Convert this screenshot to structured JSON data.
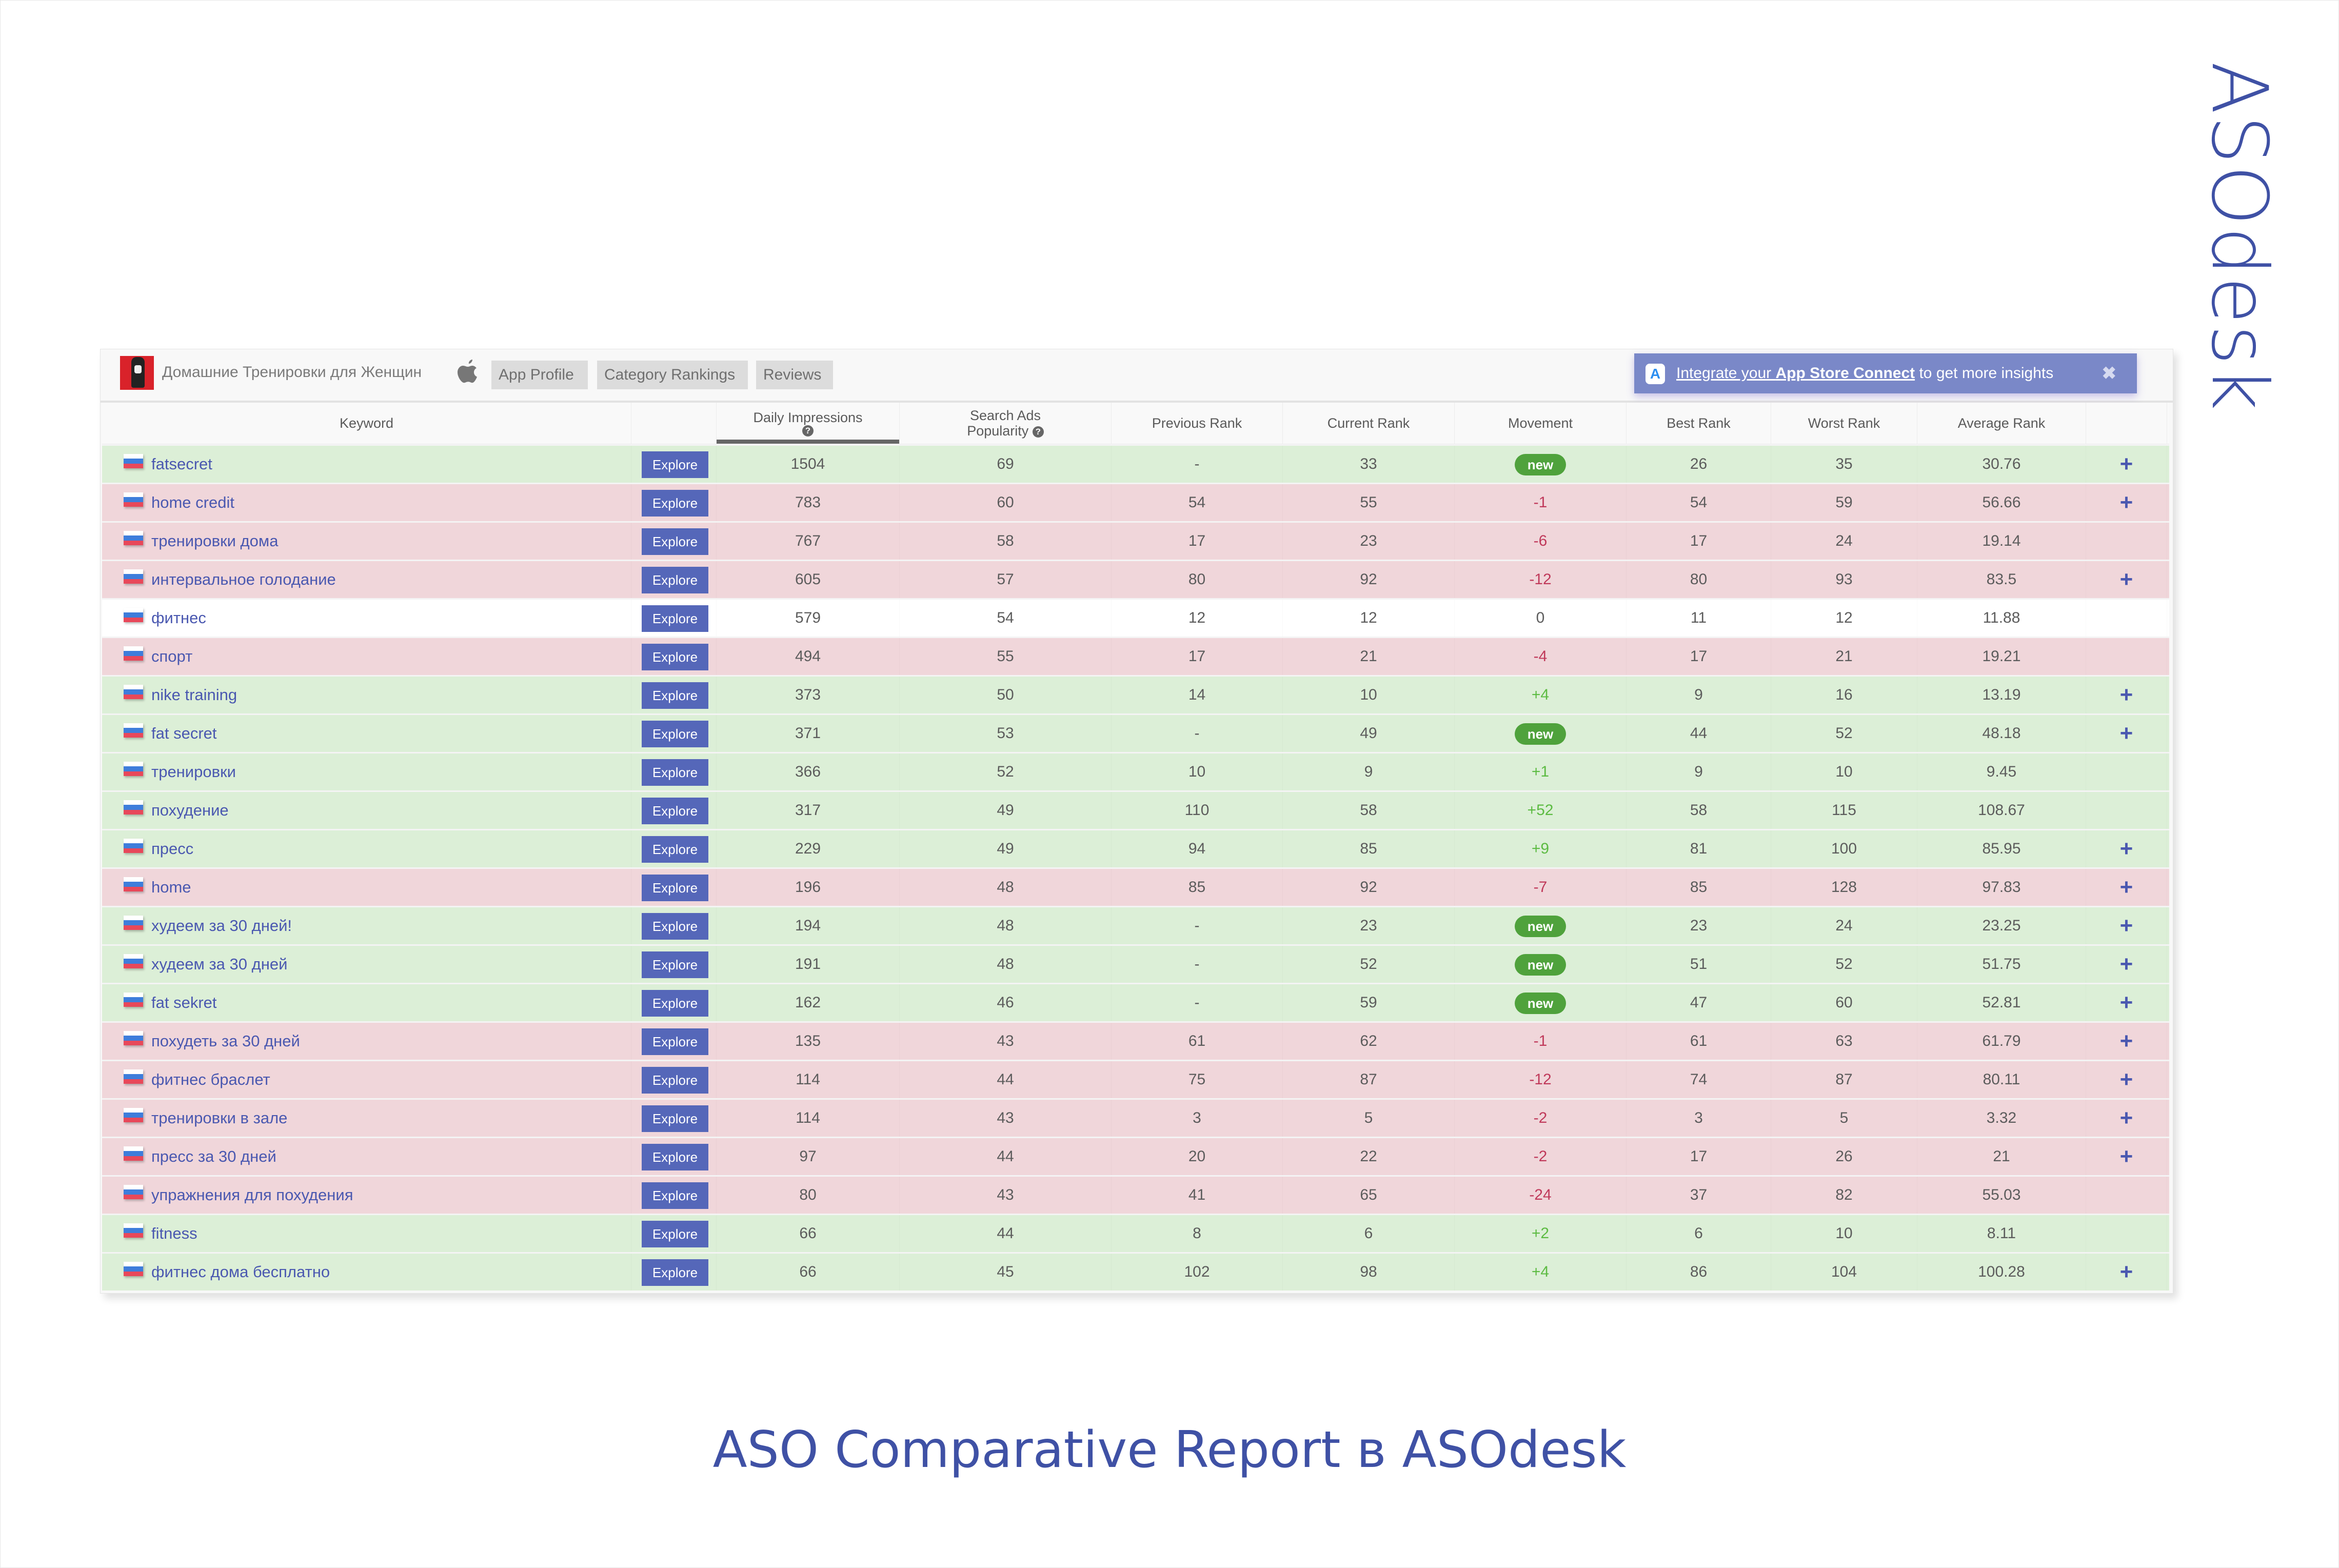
{
  "brand": {
    "logo_text": "ASOdesk",
    "accent": "#3f51a5"
  },
  "app": {
    "name": "Домашние Тренировки для Женщин",
    "platform_icon": "apple-icon"
  },
  "tabs": [
    {
      "label": "App Profile"
    },
    {
      "label": "Category Rankings"
    },
    {
      "label": "Reviews"
    }
  ],
  "banner": {
    "link_prefix": "Integrate your ",
    "link_bold": "App Store Connect",
    "suffix": " to get more insights",
    "close": "✖"
  },
  "table": {
    "headers": {
      "keyword": "Keyword",
      "explore": "",
      "daily_impressions": "Daily Impressions",
      "search_ads_popularity_1": "Search Ads",
      "search_ads_popularity_2": "Popularity",
      "previous_rank": "Previous Rank",
      "current_rank": "Current Rank",
      "movement": "Movement",
      "best_rank": "Best Rank",
      "worst_rank": "Worst Rank",
      "average_rank": "Average Rank",
      "help_glyph": "?"
    },
    "explore_label": "Explore",
    "new_label": "new",
    "plus_glyph": "+",
    "row_colors": {
      "green": "#dcefd7",
      "red": "#f0d6da",
      "white": "#ffffff"
    },
    "rows": [
      {
        "keyword": "fatsecret",
        "daily": "1504",
        "popularity": "69",
        "prev": "-",
        "curr": "33",
        "movement": "new",
        "best": "26",
        "worst": "35",
        "avg": "30.76",
        "plus": true,
        "status": "green"
      },
      {
        "keyword": "home credit",
        "daily": "783",
        "popularity": "60",
        "prev": "54",
        "curr": "55",
        "movement": "-1",
        "best": "54",
        "worst": "59",
        "avg": "56.66",
        "plus": true,
        "status": "red"
      },
      {
        "keyword": "тренировки дома",
        "daily": "767",
        "popularity": "58",
        "prev": "17",
        "curr": "23",
        "movement": "-6",
        "best": "17",
        "worst": "24",
        "avg": "19.14",
        "plus": false,
        "status": "red"
      },
      {
        "keyword": "интервальное голодание",
        "daily": "605",
        "popularity": "57",
        "prev": "80",
        "curr": "92",
        "movement": "-12",
        "best": "80",
        "worst": "93",
        "avg": "83.5",
        "plus": true,
        "status": "red"
      },
      {
        "keyword": "фитнес",
        "daily": "579",
        "popularity": "54",
        "prev": "12",
        "curr": "12",
        "movement": "0",
        "best": "11",
        "worst": "12",
        "avg": "11.88",
        "plus": false,
        "status": "white"
      },
      {
        "keyword": "спорт",
        "daily": "494",
        "popularity": "55",
        "prev": "17",
        "curr": "21",
        "movement": "-4",
        "best": "17",
        "worst": "21",
        "avg": "19.21",
        "plus": false,
        "status": "red"
      },
      {
        "keyword": "nike training",
        "daily": "373",
        "popularity": "50",
        "prev": "14",
        "curr": "10",
        "movement": "+4",
        "best": "9",
        "worst": "16",
        "avg": "13.19",
        "plus": true,
        "status": "green"
      },
      {
        "keyword": "fat secret",
        "daily": "371",
        "popularity": "53",
        "prev": "-",
        "curr": "49",
        "movement": "new",
        "best": "44",
        "worst": "52",
        "avg": "48.18",
        "plus": true,
        "status": "green"
      },
      {
        "keyword": "тренировки",
        "daily": "366",
        "popularity": "52",
        "prev": "10",
        "curr": "9",
        "movement": "+1",
        "best": "9",
        "worst": "10",
        "avg": "9.45",
        "plus": false,
        "status": "green"
      },
      {
        "keyword": "похудение",
        "daily": "317",
        "popularity": "49",
        "prev": "110",
        "curr": "58",
        "movement": "+52",
        "best": "58",
        "worst": "115",
        "avg": "108.67",
        "plus": false,
        "status": "green"
      },
      {
        "keyword": "пресс",
        "daily": "229",
        "popularity": "49",
        "prev": "94",
        "curr": "85",
        "movement": "+9",
        "best": "81",
        "worst": "100",
        "avg": "85.95",
        "plus": true,
        "status": "green"
      },
      {
        "keyword": "home",
        "daily": "196",
        "popularity": "48",
        "prev": "85",
        "curr": "92",
        "movement": "-7",
        "best": "85",
        "worst": "128",
        "avg": "97.83",
        "plus": true,
        "status": "red"
      },
      {
        "keyword": "худеем за 30 дней!",
        "daily": "194",
        "popularity": "48",
        "prev": "-",
        "curr": "23",
        "movement": "new",
        "best": "23",
        "worst": "24",
        "avg": "23.25",
        "plus": true,
        "status": "green"
      },
      {
        "keyword": "худеем за 30 дней",
        "daily": "191",
        "popularity": "48",
        "prev": "-",
        "curr": "52",
        "movement": "new",
        "best": "51",
        "worst": "52",
        "avg": "51.75",
        "plus": true,
        "status": "green"
      },
      {
        "keyword": "fat sekret",
        "daily": "162",
        "popularity": "46",
        "prev": "-",
        "curr": "59",
        "movement": "new",
        "best": "47",
        "worst": "60",
        "avg": "52.81",
        "plus": true,
        "status": "green"
      },
      {
        "keyword": "похудеть за 30 дней",
        "daily": "135",
        "popularity": "43",
        "prev": "61",
        "curr": "62",
        "movement": "-1",
        "best": "61",
        "worst": "63",
        "avg": "61.79",
        "plus": true,
        "status": "red"
      },
      {
        "keyword": "фитнес браслет",
        "daily": "114",
        "popularity": "44",
        "prev": "75",
        "curr": "87",
        "movement": "-12",
        "best": "74",
        "worst": "87",
        "avg": "80.11",
        "plus": true,
        "status": "red"
      },
      {
        "keyword": "тренировки в зале",
        "daily": "114",
        "popularity": "43",
        "prev": "3",
        "curr": "5",
        "movement": "-2",
        "best": "3",
        "worst": "5",
        "avg": "3.32",
        "plus": true,
        "status": "red"
      },
      {
        "keyword": "пресс за 30 дней",
        "daily": "97",
        "popularity": "44",
        "prev": "20",
        "curr": "22",
        "movement": "-2",
        "best": "17",
        "worst": "26",
        "avg": "21",
        "plus": true,
        "status": "red"
      },
      {
        "keyword": "упражнения для похудения",
        "daily": "80",
        "popularity": "43",
        "prev": "41",
        "curr": "65",
        "movement": "-24",
        "best": "37",
        "worst": "82",
        "avg": "55.03",
        "plus": false,
        "status": "red"
      },
      {
        "keyword": "fitness",
        "daily": "66",
        "popularity": "44",
        "prev": "8",
        "curr": "6",
        "movement": "+2",
        "best": "6",
        "worst": "10",
        "avg": "8.11",
        "plus": false,
        "status": "green"
      },
      {
        "keyword": "фитнес дома бесплатно",
        "daily": "66",
        "popularity": "45",
        "prev": "102",
        "curr": "98",
        "movement": "+4",
        "best": "86",
        "worst": "104",
        "avg": "100.28",
        "plus": true,
        "status": "green"
      }
    ]
  },
  "caption": "ASO Comparative Report в ASOdesk"
}
